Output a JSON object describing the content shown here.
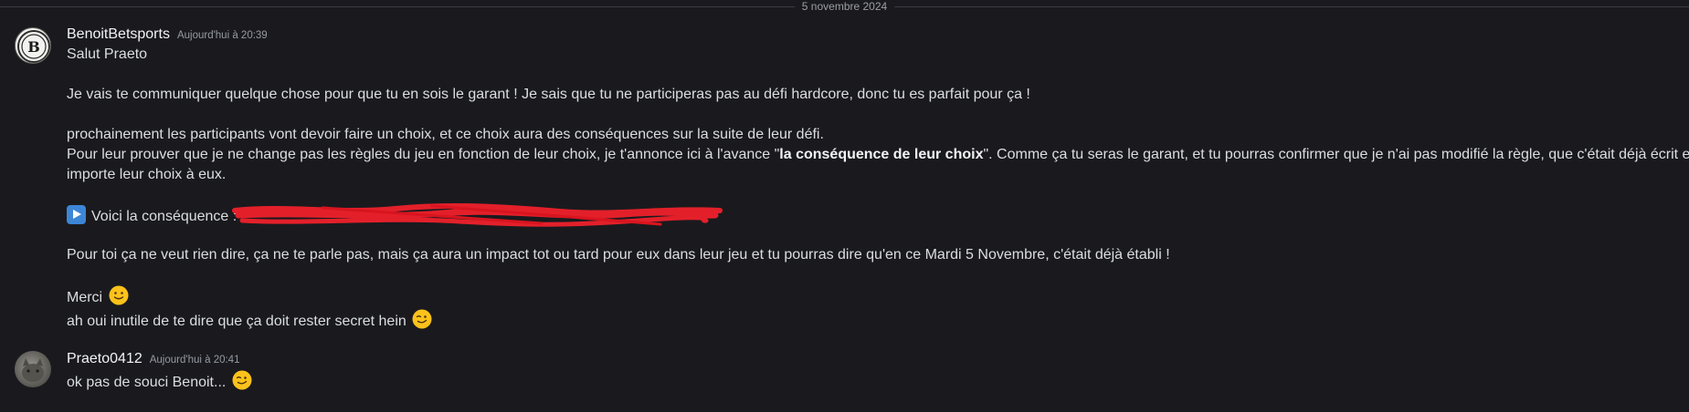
{
  "date_divider": "5 novembre 2024",
  "messages": [
    {
      "author": "BenoitBetsports",
      "time": "Aujourd'hui à 20:39",
      "avatar_icon": "betsports-logo-avatar",
      "lines": {
        "l1": "Salut Praeto",
        "l2": "Je vais te communiquer quelque chose pour que tu en sois le garant ! Je sais que tu ne participeras pas au défi hardcore, donc tu es parfait pour ça !",
        "l3": "prochainement les participants vont devoir faire un choix, et ce choix aura des conséquences sur la suite de leur défi.",
        "l4_a": "Pour leur prouver que je ne change pas les règles du jeu en fonction de leur choix, je t'annonce ici à l'avance \"",
        "l4_bold": "la conséquence de leur choix",
        "l4_b": "\". Comme ça tu seras le garant, et tu pourras confirmer que je n'ai pas modifié la règle, que c'était déjà écrit et ce peut",
        "l5": "importe leur choix à eux.",
        "l6_label": "Voici la conséquence :",
        "l7": "Pour toi ça ne veut rien dire, ça ne te parle pas, mais ça aura un impact tot ou tard pour eux dans leur jeu et tu pourras dire qu'en ce Mardi 5 Novembre, c'était déjà établi !",
        "l8": "Merci",
        "l9": "ah oui inutile de te dire que ça doit rester secret hein"
      }
    },
    {
      "author": "Praeto0412",
      "time": "Aujourd'hui à 20:41",
      "avatar_icon": "cat-photo-avatar",
      "lines": {
        "l1": "ok pas de souci Benoit..."
      }
    }
  ],
  "colors": {
    "background": "#1a1a1e",
    "text": "#dbdee1",
    "redaction": "#e3202a",
    "arrow_emoji": "#3d86d6"
  }
}
